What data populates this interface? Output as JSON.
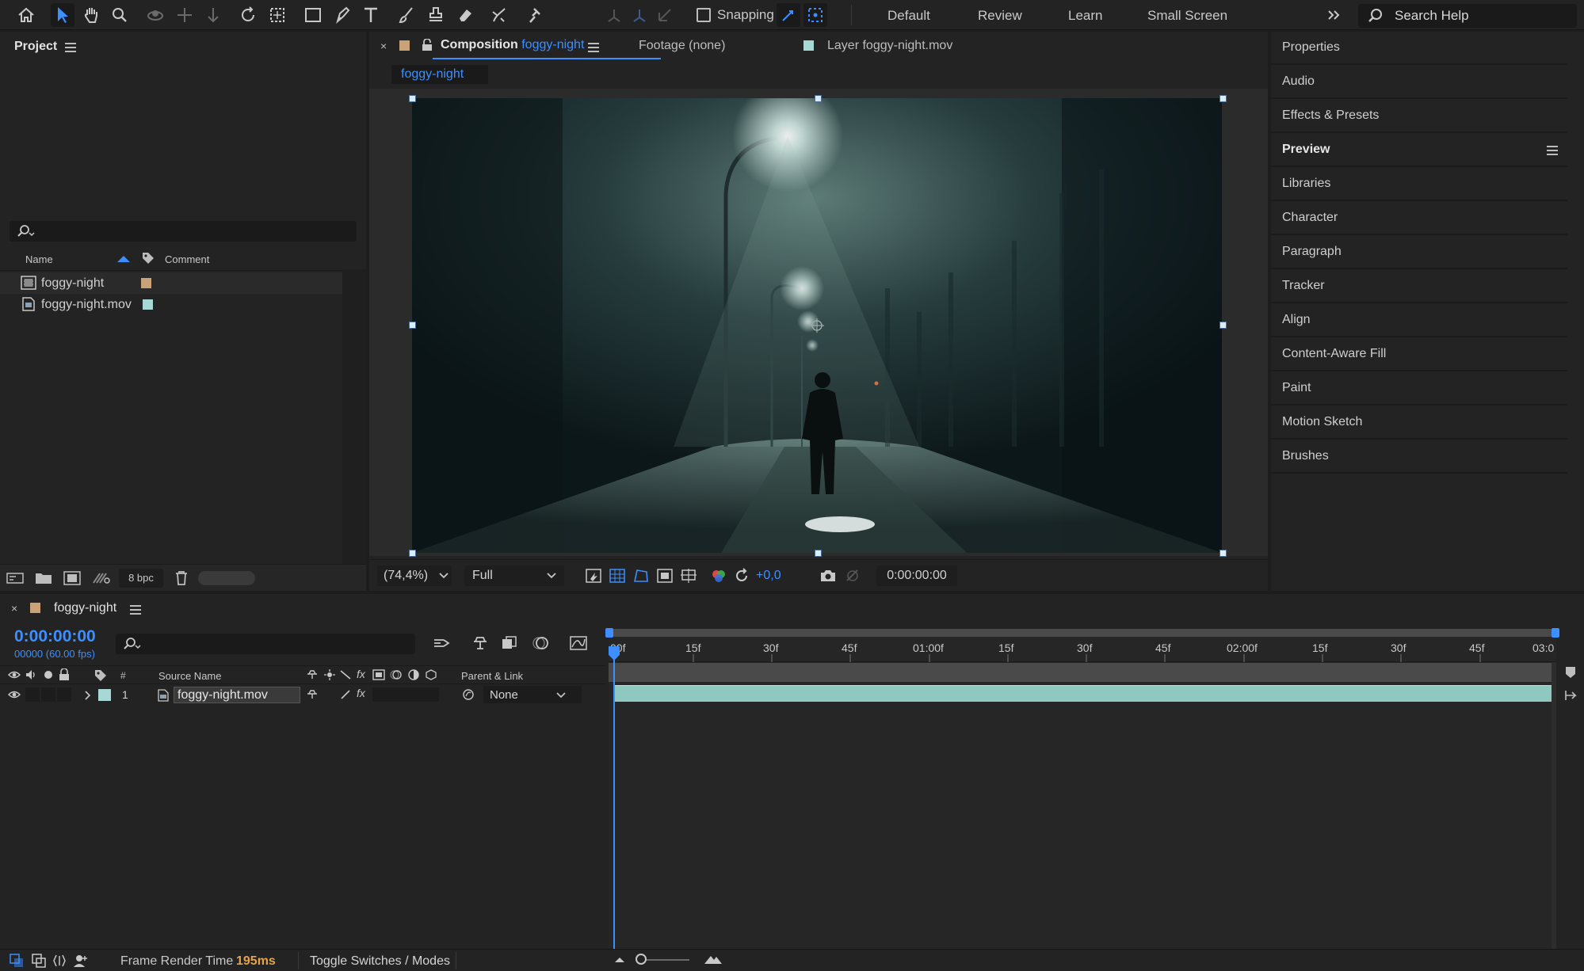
{
  "toolbar": {
    "snapping_label": "Snapping",
    "workspaces": [
      "Default",
      "Review",
      "Learn",
      "Small Screen"
    ],
    "search_placeholder": "Search Help"
  },
  "project": {
    "title": "Project",
    "columns": {
      "name": "Name",
      "comment": "Comment"
    },
    "items": [
      {
        "name": "foggy-night",
        "type": "composition",
        "label_color": "#c9a377"
      },
      {
        "name": "foggy-night.mov",
        "type": "footage",
        "label_color": "#a7d8d4"
      }
    ],
    "bpc": "8 bpc"
  },
  "viewer": {
    "tabs": {
      "composition_prefix": "Composition",
      "composition_name": "foggy-night",
      "footage": "Footage (none)",
      "layer_prefix": "Layer",
      "layer_name": "foggy-night.mov"
    },
    "breadcrumb": "foggy-night",
    "zoom": "(74,4%)",
    "resolution": "Full",
    "exposure": "+0,0",
    "timecode": "0:00:00:00"
  },
  "right_panels": [
    "Properties",
    "Audio",
    "Effects & Presets",
    "Preview",
    "Libraries",
    "Character",
    "Paragraph",
    "Tracker",
    "Align",
    "Content-Aware Fill",
    "Paint",
    "Motion Sketch",
    "Brushes"
  ],
  "timeline": {
    "comp_name": "foggy-night",
    "current_time": "0:00:00:00",
    "frame_info": "00000 (60.00 fps)",
    "columns": {
      "num": "#",
      "source": "Source Name",
      "parent": "Parent & Link"
    },
    "ruler_labels": [
      "00f",
      "15f",
      "30f",
      "45f",
      "01:00f",
      "15f",
      "30f",
      "45f",
      "02:00f",
      "15f",
      "30f",
      "45f",
      "03:0"
    ],
    "layers": [
      {
        "index": "1",
        "source": "foggy-night.mov",
        "parent": "None",
        "label_color": "#a7d8d4"
      }
    ]
  },
  "status": {
    "frame_render_label": "Frame Render Time",
    "frame_render_value": "195ms",
    "toggle_label": "Toggle Switches / Modes"
  },
  "colors": {
    "accent": "#3d8fff",
    "layer_bar": "#8ec8c0",
    "handle": "#dcecff"
  }
}
